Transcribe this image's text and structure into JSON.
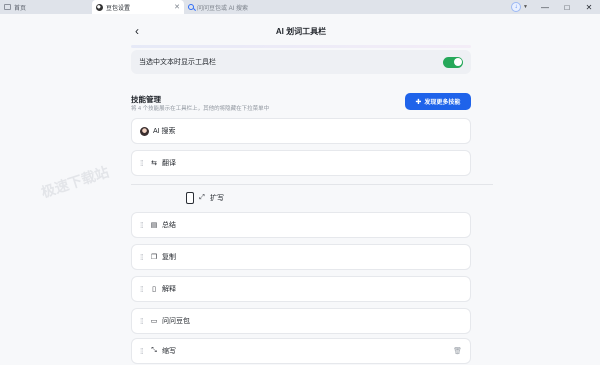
{
  "browser": {
    "tabs": [
      {
        "label": "首页",
        "icon": "home-icon"
      },
      {
        "label": "豆包设置",
        "icon": "doubao-icon",
        "active": true
      },
      {
        "label": "问问豆包或 AI 搜索",
        "icon": "search-icon"
      }
    ],
    "controls": {
      "minimize": "—",
      "maximize": "□",
      "close": "✕"
    }
  },
  "page": {
    "title": "AI 划词工具栏",
    "back": "‹"
  },
  "toggle": {
    "label": "当选中文本时显示工具栏",
    "enabled": true
  },
  "skills_section": {
    "title": "技能管理",
    "subtitle": "将 4 个技能展示在工具栏上，其他的将隐藏在下拉菜单中",
    "discover_button": "发现更多技能"
  },
  "skills": [
    {
      "label": "AI 搜索",
      "icon": "doubao-avatar-icon"
    },
    {
      "label": "翻译",
      "icon": "translate-icon"
    },
    {
      "label": "扩写",
      "icon": "expand-icon",
      "dragging": true
    },
    {
      "label": "总结",
      "icon": "summary-icon"
    },
    {
      "label": "复制",
      "icon": "copy-icon"
    },
    {
      "label": "解释",
      "icon": "explain-icon"
    },
    {
      "label": "问问豆包",
      "icon": "chat-icon"
    },
    {
      "label": "缩写",
      "icon": "shrink-icon",
      "deletable": true
    }
  ],
  "watermark": "极速下载站"
}
